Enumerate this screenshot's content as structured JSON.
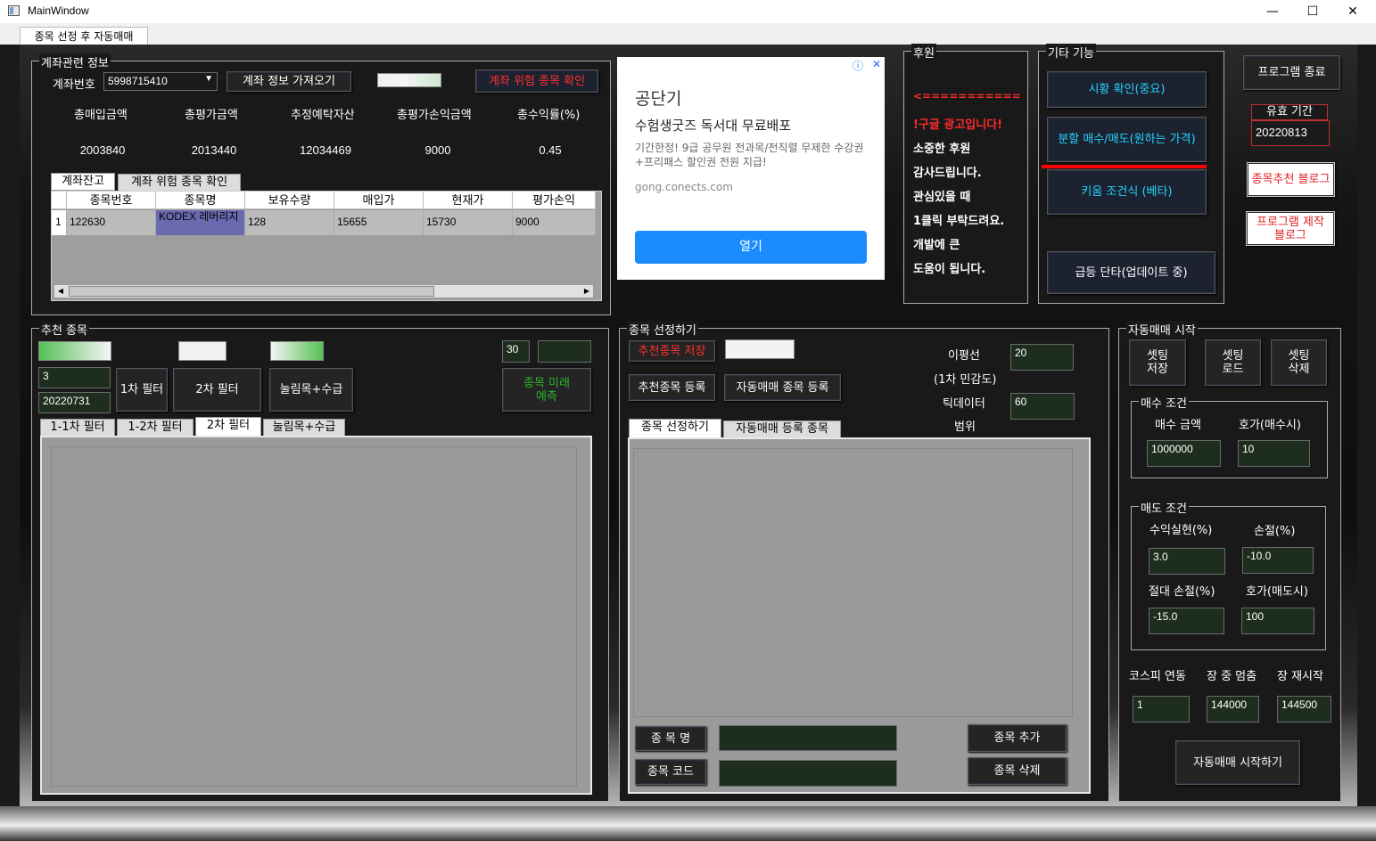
{
  "window": {
    "title": "MainWindow",
    "minimize": "—",
    "maximize": "☐",
    "close": "✕"
  },
  "main_tab": "종목 선정 후 자동매매",
  "account": {
    "group_title": "계좌관련 정보",
    "account_label": "계좌번호",
    "account_value": "5998715410",
    "fetch_button": "계좌 정보 가져오기",
    "risk_button": "계좌 위험 종목 확인",
    "summary_headers": [
      "총매입금액",
      "총평가금액",
      "추정예탁자산",
      "총평가손익금액",
      "총수익률(%)"
    ],
    "summary_values": [
      "2003840",
      "2013440",
      "12034469",
      "9000",
      "0.45"
    ],
    "tabs": [
      "계좌잔고",
      "계좌 위험 종목 확인"
    ],
    "table_headers": [
      "종목번호",
      "종목명",
      "보유수량",
      "매입가",
      "현재가",
      "평가손익"
    ],
    "table_rows": [
      {
        "idx": "1",
        "cells": [
          "122630",
          "KODEX 레버리지",
          "128",
          "15655",
          "15730",
          "9000"
        ]
      }
    ]
  },
  "ad": {
    "title": "공단기",
    "headline": "수험생굿즈 독서대 무료배포",
    "body": "기간한정! 9급 공무원 전과목/전직렬 무제한 수강권+프리패스 할인권 전원 지급!",
    "url": "gong.conects.com",
    "button": "열기",
    "info_icon": "ⓘ",
    "close_icon": "✕"
  },
  "sponsor": {
    "group_title": "후원",
    "arrow": "<===========",
    "lines": [
      "!구글 광고입니다!",
      "소중한 후원",
      "감사드립니다.",
      "관심있을 때",
      "1클릭 부탁드려요.",
      "개발에 큰",
      "도움이 됩니다."
    ]
  },
  "etc": {
    "group_title": "기타 기능",
    "buttons": [
      "시황 확인(중요)",
      "분할 매수/매도(원하는 가격)",
      "키움 조건식 (베타)",
      "급등 단타(업데이트 중)"
    ]
  },
  "right_top": {
    "exit_button": "프로그램 종료",
    "validity_label": "유효 기간",
    "validity_value": "20220813",
    "blog_button": "종목추천 블로그",
    "maker_blog_button": "프로그램 제작 블로그"
  },
  "recommend": {
    "group_title": "추천 종목",
    "input_count": "3",
    "input_date": "20220731",
    "filter1": "1차 필터",
    "filter2": "2차 필터",
    "filter3": "눌림목+수급",
    "days_value": "30",
    "predict_button": "종목 미래 예측",
    "tabs": [
      "1-1차 필터",
      "1-2차 필터",
      "2차 필터",
      "눌림목+수급"
    ]
  },
  "select": {
    "group_title": "종목 선정하기",
    "save_button": "추천종목 저장",
    "register_button": "추천종목 등록",
    "auto_register_button": "자동매매 종목 등록",
    "ma_label": "이평선",
    "ma_sub": "(1차 민감도)",
    "tick_label": "틱데이터",
    "tick_sub": "범위",
    "ma_value": "20",
    "tick_value": "60",
    "tabs": [
      "종목 선정하기",
      "자동매매 등록 종목"
    ],
    "name_label": "종 목 명",
    "code_label": "종목 코드",
    "add_button": "종목 추가",
    "delete_button": "종목 삭제"
  },
  "auto": {
    "group_title": "자동매매 시작",
    "save": "셋팅 저장",
    "load": "셋팅 로드",
    "delete": "셋팅 삭제",
    "buy_title": "매수 조건",
    "buy_amount_label": "매수 금액",
    "buy_tick_label": "호가(매수시)",
    "buy_amount": "1000000",
    "buy_tick": "10",
    "sell_title": "매도 조건",
    "profit_label": "수익실현(%)",
    "loss_label": "손절(%)",
    "profit": "3.0",
    "loss": "-10.0",
    "abs_loss_label": "절대 손절(%)",
    "sell_tick_label": "호가(매도시)",
    "abs_loss": "-15.0",
    "sell_tick": "100",
    "kospi_label": "코스피 연동",
    "pause_label": "장 중 멈춤",
    "restart_label": "장 재시작",
    "kospi": "1",
    "pause": "144000",
    "restart": "144500",
    "start_button": "자동매매 시작하기"
  }
}
